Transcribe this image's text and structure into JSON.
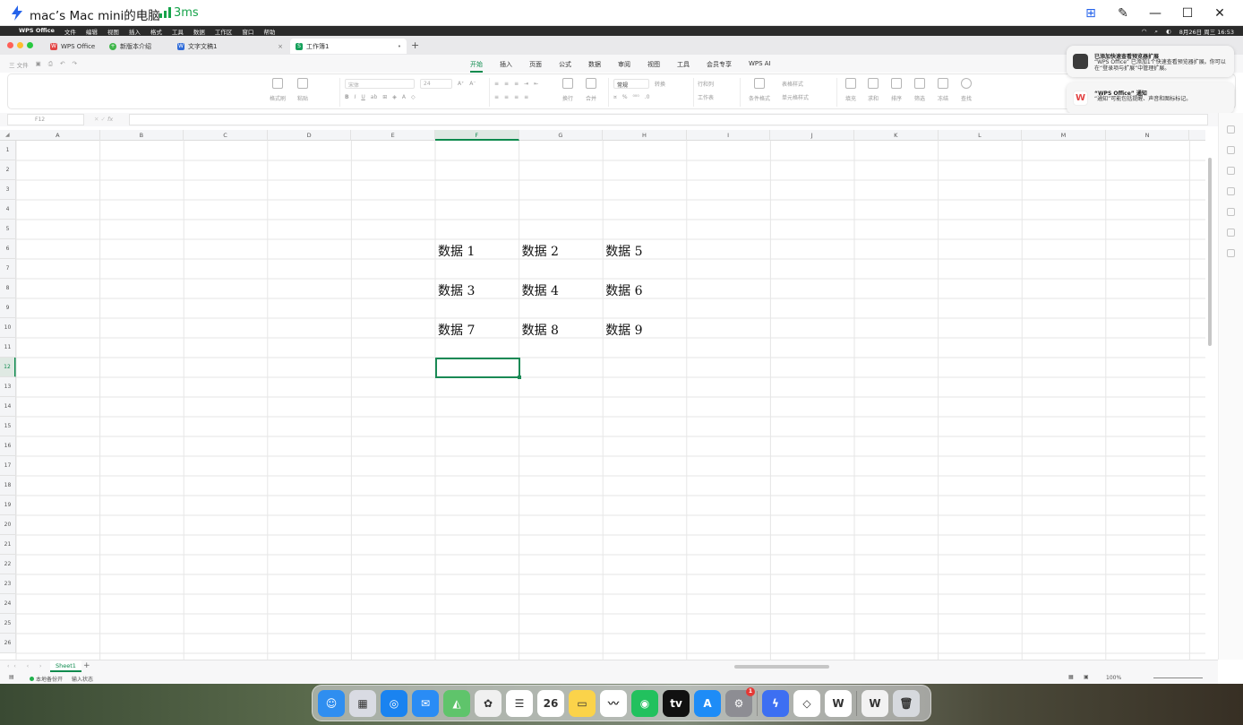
{
  "remote_window": {
    "title": "mac’s Mac mini的电脑",
    "latency": "3ms",
    "controls": [
      "⊞",
      "✎",
      "—",
      "☐",
      "✕"
    ]
  },
  "mac_menubar": {
    "apple": "",
    "app_name": "WPS Office",
    "menus": [
      "文件",
      "编辑",
      "视图",
      "插入",
      "格式",
      "工具",
      "数据",
      "工作区",
      "窗口",
      "帮助"
    ],
    "clock": "8月26日 周三 16:53"
  },
  "window_tabs": [
    {
      "label": "WPS Office",
      "icon": "wps-icon",
      "color": "#e24545"
    },
    {
      "label": "新版本介绍",
      "icon": "intro-icon",
      "color": "#3fb64a"
    },
    {
      "label": "文字文稿1",
      "icon": "writer-icon",
      "color": "#2f6bd8"
    },
    {
      "label": "工作簿1",
      "icon": "spreadsheet-icon",
      "color": "#14a05a",
      "active": true
    }
  ],
  "quick_toolbar": {
    "file_label": "三 文件"
  },
  "ribbon_tabs": [
    "开始",
    "插入",
    "页面",
    "公式",
    "数据",
    "审阅",
    "视图",
    "工具",
    "会员专享",
    "WPS AI"
  ],
  "active_ribbon_tab": "开始",
  "ribbon": {
    "format_painter": "格式刷",
    "paste": "粘贴",
    "font_name": "宋体",
    "font_size": "24",
    "number_format": "常规",
    "wrap": "换行",
    "merge": "合并",
    "convert": "转换",
    "row_col": "行和列",
    "worksheet": "工作表",
    "conditional_format": "条件格式",
    "table_style": "表格样式",
    "cell_style": "单元格样式",
    "fill": "填充",
    "sum": "求和",
    "sort": "排序",
    "filter": "筛选",
    "freeze": "冻结",
    "find": "查找"
  },
  "formula_bar": {
    "name_box": "F12",
    "fx": "fx",
    "content": ""
  },
  "columns": [
    "A",
    "B",
    "C",
    "D",
    "E",
    "F",
    "G",
    "H",
    "I",
    "J",
    "K",
    "L",
    "M",
    "N"
  ],
  "rows": [
    "1",
    "2",
    "3",
    "4",
    "5",
    "6",
    "7",
    "8",
    "9",
    "10",
    "11",
    "12",
    "13",
    "14",
    "15",
    "16",
    "17",
    "18",
    "19",
    "20",
    "21",
    "22",
    "23",
    "24",
    "25",
    "26"
  ],
  "selected_cell": {
    "col": "F",
    "row": "12"
  },
  "cells": [
    {
      "ref": "F6",
      "value": "数据 1"
    },
    {
      "ref": "G6",
      "value": "数据 2"
    },
    {
      "ref": "H6",
      "value": "数据 5"
    },
    {
      "ref": "F8",
      "value": "数据 3"
    },
    {
      "ref": "G8",
      "value": "数据 4"
    },
    {
      "ref": "H8",
      "value": "数据 6"
    },
    {
      "ref": "F10",
      "value": "数据 7"
    },
    {
      "ref": "G10",
      "value": "数据 8"
    },
    {
      "ref": "H10",
      "value": "数据 9"
    }
  ],
  "sheet_tabs": [
    "Sheet1"
  ],
  "status_bar": {
    "backup": "本地备份开",
    "mode": "输入状态",
    "zoom": "100%"
  },
  "notifications": [
    {
      "title": "已添加快速查看预览器扩展",
      "body": "“WPS Office” 已添加1个快速查看预览器扩展。你可以在“登录项与扩展”中管理扩展。"
    },
    {
      "title": "“WPS Office” 通知",
      "body": "“通知”可能包括提醒、声音和图标标记。"
    }
  ],
  "dock": [
    {
      "name": "Finder",
      "color": "#2f8ef0",
      "glyph": "☺"
    },
    {
      "name": "Launchpad",
      "color": "#d9dbe3",
      "glyph": "▦"
    },
    {
      "name": "Safari",
      "color": "#1a83f0",
      "glyph": "◎"
    },
    {
      "name": "Mail",
      "color": "#2a8cf5",
      "glyph": "✉"
    },
    {
      "name": "Maps",
      "color": "#5fc46b",
      "glyph": "◭"
    },
    {
      "name": "Photos",
      "color": "#f0f0f0",
      "glyph": "✿"
    },
    {
      "name": "Reminders",
      "color": "#ffffff",
      "glyph": "☰"
    },
    {
      "name": "Calendar",
      "color": "#ffffff",
      "glyph": "26"
    },
    {
      "name": "Notes",
      "color": "#fbd34a",
      "glyph": "▭"
    },
    {
      "name": "Freeform",
      "color": "#ffffff",
      "glyph": "〰"
    },
    {
      "name": "WeChat",
      "color": "#22c15e",
      "glyph": "◉"
    },
    {
      "name": "Apple TV",
      "color": "#111111",
      "glyph": "tv"
    },
    {
      "name": "App Store",
      "color": "#1e8cf7",
      "glyph": "A"
    },
    {
      "name": "System Settings",
      "color": "#8d8d93",
      "glyph": "⚙",
      "badge": "1"
    },
    {
      "name": "Remote Desktop",
      "color": "#3d6ff2",
      "glyph": "ϟ"
    },
    {
      "name": "Quark",
      "color": "#ffffff",
      "glyph": "◇"
    },
    {
      "name": "WPS Office",
      "color": "#ffffff",
      "glyph": "W"
    },
    {
      "name": "WPS Doc",
      "color": "#f2f2f2",
      "glyph": "W"
    },
    {
      "name": "Trash",
      "color": "#d6d9de",
      "glyph": "🗑"
    }
  ]
}
